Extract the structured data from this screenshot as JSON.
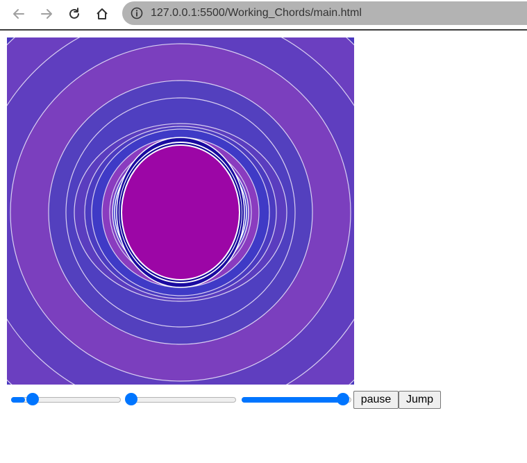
{
  "browser": {
    "url": "127.0.0.1:5500/Working_Chords/main.html"
  },
  "icons": {
    "back": "arrow-left-icon",
    "forward": "arrow-right-icon",
    "reload": "reload-icon",
    "home": "home-icon",
    "info": "info-icon"
  },
  "colors": {
    "slider_accent": "#0075ff",
    "ring_purple": "#7b3fbe",
    "ring_blue": "#4b3bc0",
    "center_magenta": "#9c06a6"
  },
  "controls": {
    "slider_values": [
      0.1,
      0.05,
      0.98
    ],
    "pause_label": "pause",
    "jump_label": "Jump"
  }
}
